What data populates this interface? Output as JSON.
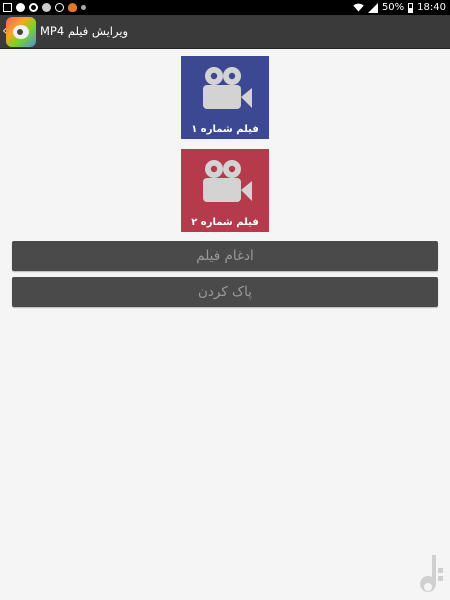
{
  "status_bar": {
    "time": "18:40",
    "battery": "50%",
    "left_icons": [
      "gallery-icon",
      "circle-icon",
      "ring-icon",
      "heart-icon",
      "check-icon",
      "fire-icon",
      "dot-icon"
    ],
    "right_icons": [
      "wifi-icon",
      "signal-icon",
      "battery-icon"
    ]
  },
  "app_bar": {
    "title": "ویرایش فیلم MP4",
    "back_icon": "chevron-left-icon",
    "app_icon": "app-logo-icon"
  },
  "tiles": [
    {
      "label": "فیلم شماره ۱",
      "icon": "camera-icon",
      "color": "#3d4892"
    },
    {
      "label": "فیلم شماره ۲",
      "icon": "camera-icon",
      "color": "#b53a4c"
    }
  ],
  "buttons": {
    "merge_label": "ادغام فیلم",
    "clear_label": "پاک کردن"
  },
  "colors": {
    "background": "#f5f5f5",
    "app_bar": "#3a3a3a",
    "button": "#4a4a4a",
    "button_text": "#9a9a9a"
  }
}
